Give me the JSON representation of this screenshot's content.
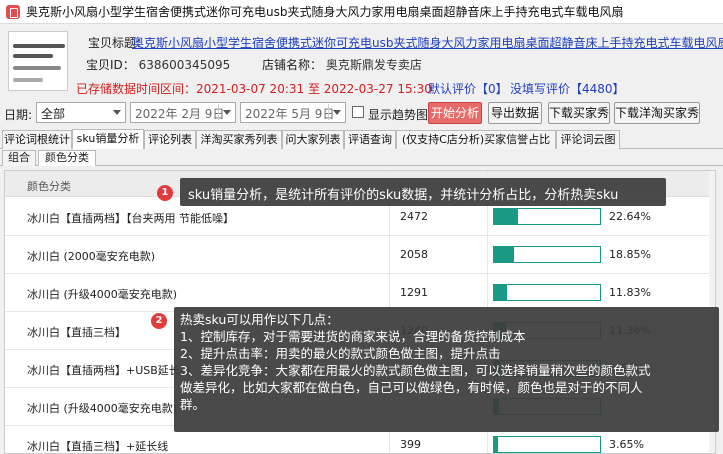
{
  "window": {
    "title": "奥克斯小风扇小型学生宿舍便携式迷你可充电usb夹式随身大风力家用电扇桌面超静音床上手持充电式车载电风扇"
  },
  "info": {
    "title_label": "宝贝标题：",
    "title_value": "奥克斯小风扇小型学生宿舍便携式迷你可充电usb夹式随身大风力家用电扇桌面超静音床上手持充电式车载电风扇",
    "id_label": "宝贝ID：",
    "id_value": "638600345095",
    "shop_label": "店铺名称：",
    "shop_value": "奥克斯鼎发专卖店",
    "time_range": "已存储数据时间区间：2021-03-07 20:31 至 2022-03-27 15:30",
    "default_review": "默认评价【0】",
    "no_review": "没填写评价【4480】"
  },
  "controls": {
    "date_label": "日期:",
    "range_select": "全部",
    "start_date": "2022年 2月 9日",
    "end_date": "2022年 5月 9日",
    "trend_checkbox_label": "显示趋势图",
    "trend_checked": false,
    "analyze_button": "开始分析",
    "export_button": "导出数据",
    "download_buyer_button": "下载买家秀",
    "download_yangtao_button": "下载洋淘买家秀"
  },
  "tabs": [
    "评论词根统计",
    "sku销量分析",
    "评论列表",
    "洋淘买家秀列表",
    "问大家列表",
    "评语查询",
    "(仅支持C店分析)买家信誉占比",
    "评论词云图"
  ],
  "subtabs": [
    "组合",
    "颜色分类"
  ],
  "grid": {
    "col_color": "颜色分类",
    "rows": [
      {
        "name": "冰川白【直插两档】【台夹两用 节能低噪】",
        "count": "2472",
        "pct": "22.64%",
        "fraction": 0.2264
      },
      {
        "name": "冰川白 (2000毫安充电款)",
        "count": "2058",
        "pct": "18.85%",
        "fraction": 0.1885
      },
      {
        "name": "冰川白 (升级4000毫安充电款)",
        "count": "1291",
        "pct": "11.83%",
        "fraction": 0.1183
      },
      {
        "name": "冰川白【直插三档】",
        "count": "1240",
        "pct": "11.36%",
        "fraction": 0.1136
      },
      {
        "name": "冰川白【直插两档】+USB延长线",
        "count": "",
        "pct": "5.52%",
        "fraction": 0.0552
      },
      {
        "name": "冰川白 (升级4000毫安充电款)",
        "count": "",
        "pct": "",
        "fraction": 0.05
      },
      {
        "name": "冰川白【直插三档】+延长线",
        "count": "399",
        "pct": "3.65%",
        "fraction": 0.0365
      }
    ]
  },
  "tooltips": {
    "tip1_badge": "1",
    "tip1_text": "sku销量分析，是统计所有评价的sku数据，并统计分析占比，分析热卖sku",
    "tip2_badge": "2",
    "tip2_lines": [
      "热卖sku可以用作以下几点：",
      "1、控制库存，对于需要进货的商家来说，合理的备货控制成本",
      "2、提升点击率：用卖的最火的款式颜色做主图，提升点击",
      "3、差异化竞争：大家都在用最火的款式颜色做主图，可以选择销量稍次些的颜色款式",
      "做差异化，比如大家都在做白色，自己可以做绿色，有时候，颜色也是对于的不同人",
      "群。"
    ]
  }
}
